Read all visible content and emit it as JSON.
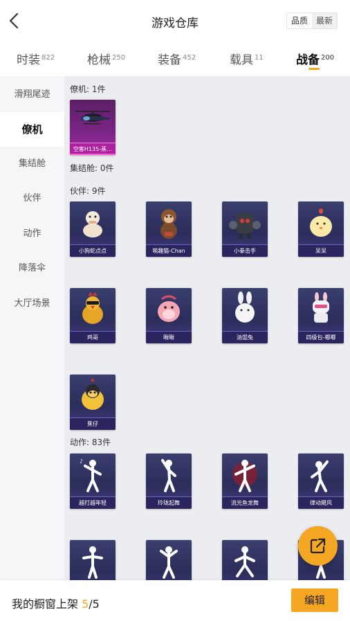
{
  "header": {
    "title": "游戏仓库",
    "sort_quality": "品质",
    "sort_newest": "最新"
  },
  "tabs": [
    {
      "label": "时装",
      "count": "822"
    },
    {
      "label": "枪械",
      "count": "250"
    },
    {
      "label": "装备",
      "count": "452"
    },
    {
      "label": "载具",
      "count": "11"
    },
    {
      "label": "战备",
      "count": "200"
    }
  ],
  "sidebar": {
    "items": [
      "滑翔尾迹",
      "僚机",
      "集结舱",
      "伙伴",
      "动作",
      "降落伞",
      "大厅场景"
    ]
  },
  "sections": {
    "wingman": "僚机: 1件",
    "pod": "集结舱: 0件",
    "partner": "伙伴: 9件",
    "action": "动作: 83件"
  },
  "wingman_items": [
    "空客H135-蒸…"
  ],
  "partner_items": [
    "小狗蛇点点",
    "萌趣猫-Chan",
    "小拳击手",
    "呆呆",
    "鸡哥",
    "啾啾",
    "汹馄兔",
    "四级包-嘟嘟",
    "蕉仔"
  ],
  "action_items": [
    "越打越年轻",
    "玲珑起舞",
    "流光鱼龙舞",
    "律动飓风",
    "",
    "",
    "",
    ""
  ],
  "footer": {
    "label": "我的橱窗上架 ",
    "count": "5",
    "total": "/5",
    "edit_label": "编辑"
  },
  "colors": {
    "accent": "#f5a623"
  }
}
